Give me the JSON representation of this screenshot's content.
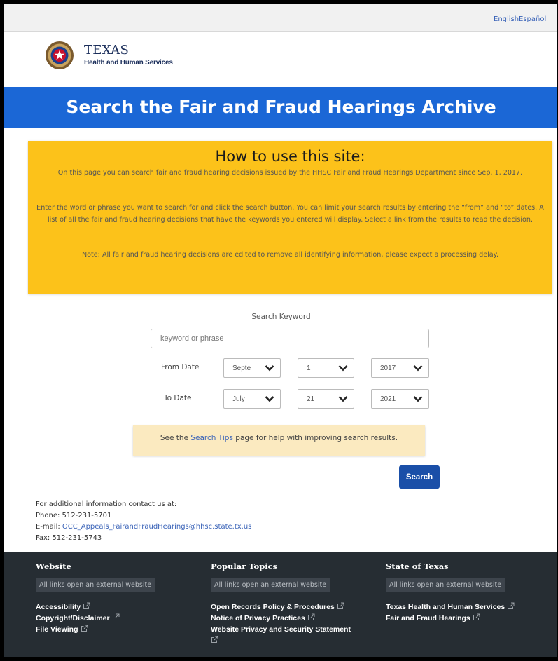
{
  "lang": {
    "english": "English",
    "espanol": "Español"
  },
  "logo": {
    "title": "TEXAS",
    "subtitle": "Health and Human Services"
  },
  "banner": {
    "title": "Search the Fair and Fraud Hearings Archive"
  },
  "howto": {
    "heading": "How to use this site:",
    "p1": "On this page you can search fair and fraud hearing decisions issued by the HHSC Fair and Fraud Hearings Department since Sep. 1, 2017.",
    "p2": "Enter the word or phrase you want to search for and click the search button. You can limit your search results by entering the “from” and “to” dates. A list of all the fair and fraud hearing decisions that have the keywords you entered will display. Select a link from the results to read the decision.",
    "p3": "Note: All fair and fraud hearing decisions are edited to remove all identifying information, please expect a processing delay."
  },
  "search": {
    "keyword_label": "Search Keyword",
    "keyword_placeholder": "keyword or phrase",
    "from_label": "From Date",
    "from_month": "Septe",
    "from_day": "1",
    "from_year": "2017",
    "to_label": "To Date",
    "to_month": "July",
    "to_day": "21",
    "to_year": "2021",
    "tips_prefix": "See the ",
    "tips_link": "Search Tips",
    "tips_suffix": " page for help with improving search results.",
    "button": "Search"
  },
  "contact": {
    "intro": "For additional information contact us at:",
    "phone": "Phone: 512-231-5701",
    "email_label": "E-mail: ",
    "email": "OCC_Appeals_FairandFraudHearings@hhsc.state.tx.us",
    "fax": "Fax: 512-231-5743"
  },
  "footer": {
    "col1": {
      "title": "Website",
      "note": "All links open an external website",
      "links": [
        "Accessibility",
        "Copyright/Disclaimer",
        "File Viewing"
      ]
    },
    "col2": {
      "title": "Popular Topics",
      "note": "All links open an external website",
      "links": [
        "Open Records Policy & Procedures",
        "Notice of Privacy Practices",
        "Website Privacy and Security Statement"
      ]
    },
    "col3": {
      "title": "State of Texas",
      "note": "All links open an external website",
      "links": [
        "Texas Health and Human Services",
        "Fair and Fraud Hearings"
      ]
    }
  },
  "colors": {
    "banner": "#1b67d6",
    "howto_bg": "#fcc21a",
    "tips_bg": "#fbeac0",
    "button": "#1a4fa8",
    "footer": "#262d33"
  }
}
